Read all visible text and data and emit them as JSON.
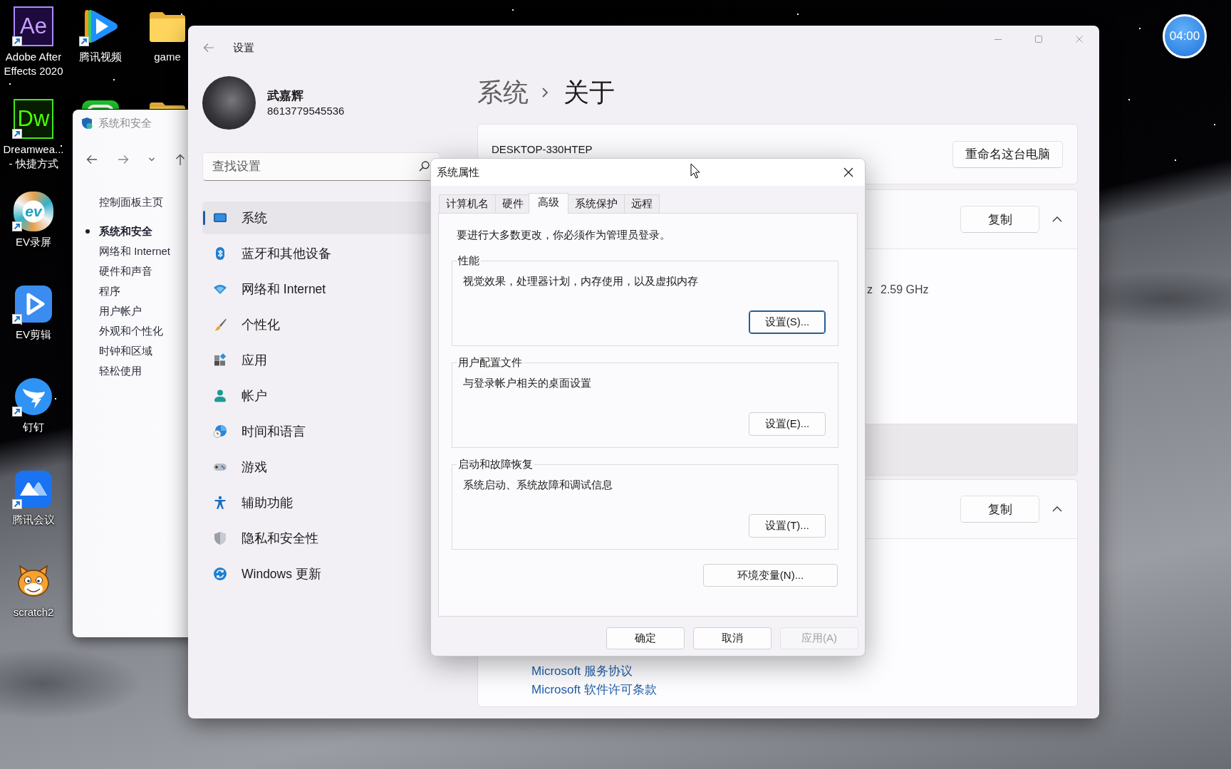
{
  "desktop": {
    "columns": [
      [
        {
          "label": "Adobe After Effects 2020",
          "glyph": "Ae",
          "shortcut": true
        },
        {
          "label": "Dreamwea... - 快捷方式",
          "glyph": "Dw",
          "shortcut": true
        },
        {
          "label": "EV录屏",
          "glyph": "ev",
          "shortcut": true
        },
        {
          "label": "EV剪辑",
          "shortcut": true
        },
        {
          "label": "钉钉",
          "shortcut": true
        },
        {
          "label": "腾讯会议",
          "shortcut": true
        },
        {
          "label": "scratch2",
          "shortcut": false
        }
      ],
      [
        {
          "label": "腾讯视频",
          "shortcut": true
        },
        {}
      ],
      [
        {
          "label": "game",
          "shortcut": false
        },
        {}
      ]
    ]
  },
  "timer": {
    "time": "04:00"
  },
  "control_panel": {
    "title": "系统和安全",
    "home": "控制面板主页",
    "categories": [
      {
        "label": "系统和安全",
        "selected": true
      },
      {
        "label": "网络和 Internet",
        "selected": false
      },
      {
        "label": "硬件和声音",
        "selected": false
      },
      {
        "label": "程序",
        "selected": false
      },
      {
        "label": "用户帐户",
        "selected": false
      },
      {
        "label": "外观和个性化",
        "selected": false
      },
      {
        "label": "时钟和区域",
        "selected": false
      },
      {
        "label": "轻松使用",
        "selected": false
      }
    ]
  },
  "settings": {
    "title": "设置",
    "user": {
      "name": "武嘉辉",
      "account": "8613779545536"
    },
    "search": {
      "placeholder": "查找设置"
    },
    "nav": [
      {
        "label": "系统",
        "selected": true
      },
      {
        "label": "蓝牙和其他设备",
        "selected": false
      },
      {
        "label": "网络和 Internet",
        "selected": false
      },
      {
        "label": "个性化",
        "selected": false
      },
      {
        "label": "应用",
        "selected": false
      },
      {
        "label": "帐户",
        "selected": false
      },
      {
        "label": "时间和语言",
        "selected": false
      },
      {
        "label": "游戏",
        "selected": false
      },
      {
        "label": "辅助功能",
        "selected": false
      },
      {
        "label": "隐私和安全性",
        "selected": false
      },
      {
        "label": "Windows 更新",
        "selected": false
      }
    ],
    "breadcrumb": [
      "系统",
      "关于"
    ],
    "device": {
      "name": "DESKTOP-330HTEP",
      "rename_button": "重命名这台电脑"
    },
    "sections": [
      {
        "kind": "expander",
        "copy_button": "复制",
        "expanded": true,
        "fragments": [
          "z",
          "2.59 GHz"
        ]
      },
      {
        "kind": "band"
      },
      {
        "kind": "expander",
        "copy_button": "复制",
        "expanded": true,
        "links": [
          "Microsoft 服务协议",
          "Microsoft 软件许可条款"
        ]
      }
    ]
  },
  "dialog": {
    "title": "系统属性",
    "tabs": [
      {
        "label": "计算机名",
        "selected": false
      },
      {
        "label": "硬件",
        "selected": false
      },
      {
        "label": "高级",
        "selected": true
      },
      {
        "label": "系统保护",
        "selected": false
      },
      {
        "label": "远程",
        "selected": false
      }
    ],
    "notice": "要进行大多数更改，你必须作为管理员登录。",
    "groups": [
      {
        "legend": "性能",
        "description": "视觉效果，处理器计划，内存使用，以及虚拟内存",
        "button": "设置(S)...",
        "focused": true
      },
      {
        "legend": "用户配置文件",
        "description": "与登录帐户相关的桌面设置",
        "button": "设置(E)...",
        "focused": false
      },
      {
        "legend": "启动和故障恢复",
        "description": "系统启动、系统故障和调试信息",
        "button": "设置(T)...",
        "focused": false
      }
    ],
    "env_button": "环境变量(N)...",
    "buttons": [
      {
        "label": "确定",
        "disabled": false
      },
      {
        "label": "取消",
        "disabled": false
      },
      {
        "label": "应用(A)",
        "disabled": true
      }
    ]
  }
}
